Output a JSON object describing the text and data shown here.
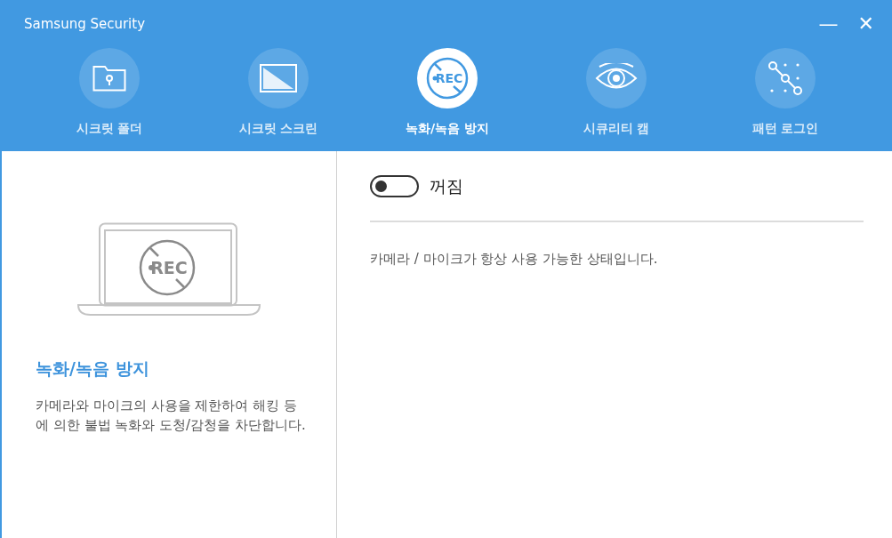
{
  "window": {
    "title": "Samsung Security",
    "controls": [
      "—",
      "✕"
    ]
  },
  "tabs": [
    {
      "kind": "folder",
      "label": "시크릿 폴더",
      "selected": false
    },
    {
      "kind": "screen",
      "label": "시크릿 스크린",
      "selected": false
    },
    {
      "kind": "rec",
      "label": "녹화/녹음 방지",
      "selected": true,
      "icon_text": "REC"
    },
    {
      "kind": "eye",
      "label": "시큐리티 캠",
      "selected": false
    },
    {
      "kind": "pattern",
      "label": "패턴 로그인",
      "selected": false
    }
  ],
  "info": {
    "illustration_text": "REC",
    "title": "녹화/녹음 방지",
    "description": "카메라와 마이크의 사용을 제한하여 해킹 등에 의한 불법 녹화와 도청/감청을 차단합니다."
  },
  "setting": {
    "on": false,
    "label": "꺼짐",
    "status": "카메라 / 마이크가 항상 사용 가능한 상태입니다."
  }
}
